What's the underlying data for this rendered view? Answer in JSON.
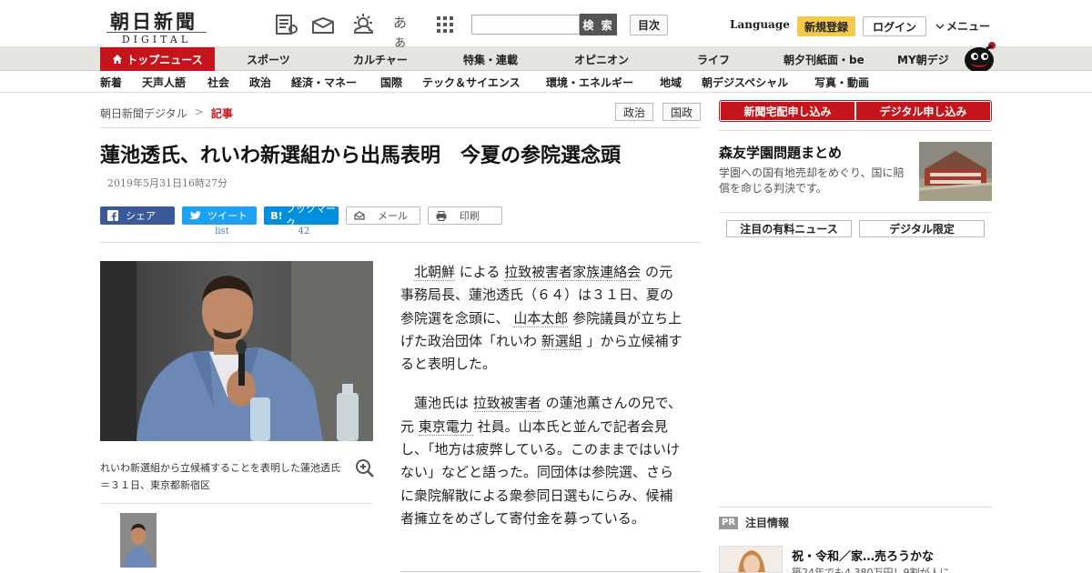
{
  "header": {
    "logo_jp": "朝日新聞",
    "logo_en": "DIGITAL",
    "search_placeholder": "",
    "search_button": "検 索",
    "toc_button": "目次",
    "language": "Language",
    "signup": "新規登録",
    "login": "ログイン",
    "menu": "メニュー",
    "icons": [
      "newspaper-icon",
      "mail-tray-icon",
      "weather-icon",
      "text-size-icon",
      "grid-icon"
    ],
    "text_size_glyph": "あぁ"
  },
  "nav_primary": [
    {
      "label": "トップニュース"
    },
    {
      "label": "スポーツ"
    },
    {
      "label": "カルチャー"
    },
    {
      "label": "特集・連載"
    },
    {
      "label": "オピニオン"
    },
    {
      "label": "ライフ"
    },
    {
      "label": "朝夕刊紙面・be"
    },
    {
      "label": "MY朝デジ"
    }
  ],
  "nav_secondary": [
    {
      "label": "新着"
    },
    {
      "label": "天声人語"
    },
    {
      "label": "社会"
    },
    {
      "label": "政治"
    },
    {
      "label": "経済・マネー"
    },
    {
      "label": "国際"
    },
    {
      "label": "テック＆サイエンス"
    },
    {
      "label": "環境・エネルギー"
    },
    {
      "label": "地域"
    },
    {
      "label": "朝デジスペシャル"
    },
    {
      "label": "写真・動画"
    }
  ],
  "breadcrumb": {
    "home": "朝日新聞デジタル",
    "sep": ">",
    "current": "記事"
  },
  "tags": [
    "政治",
    "国政"
  ],
  "article": {
    "headline": "蓮池透氏、れいわ新選組から出馬表明　今夏の参院選念頭",
    "date": "2019年5月31日16時27分",
    "share": {
      "facebook": "シェア",
      "twitter": "ツイート",
      "hatena": "ブックマーク",
      "mail": "メール",
      "print": "印刷",
      "twitter_count": "list",
      "hatena_count": "42"
    },
    "caption": "れいわ新選組から立候補することを表明した蓮池透氏＝３１日、東京都新宿区",
    "p1": {
      "link1": "北朝鮮",
      "t1": "による",
      "link2": "拉致被害者家族連絡会",
      "t2": "の元事務局長、蓮池透氏（６４）は３１日、夏の参院選を念頭に、",
      "link3": "山本太郎",
      "t3": "参院議員が立ち上げた政治団体「れいわ",
      "link4": "新選組",
      "t4": "」から立候補すると表明した。"
    },
    "p2": {
      "t1": "蓮池氏は",
      "link1": "拉致被害者",
      "t2": "の蓮池薫さんの兄で、元",
      "link2": "東京電力",
      "t3": "社員。山本氏と並んで記者会見し、「地方は疲弊している。このままではいけない」などと語った。同団体は参院選、さらに衆院解散による衆参同日選もにらみ、候補者擁立をめざして寄付金を募っている。"
    }
  },
  "sidebar": {
    "subscribe_paper": "新聞宅配申し込み",
    "subscribe_digital": "デジタル申し込み",
    "feature_title": "森友学園問題まとめ",
    "feature_desc": "学園への国有地売却をめぐり、国に賠償を命じる判決です。",
    "tab_paid": "注目の有料ニュース",
    "tab_digital": "デジタル限定",
    "pr_badge": "PR",
    "pr_heading": "注目情報",
    "pr_title": "祝・令和／家…売ろうかな",
    "pr_sub": "築24年でも4,380万円！9割が人に"
  },
  "colors": {
    "brand_red": "#c4151c",
    "signup_yellow": "#f2c94c",
    "facebook": "#3b5998",
    "twitter": "#1da1f2",
    "hatena": "#008fde"
  }
}
